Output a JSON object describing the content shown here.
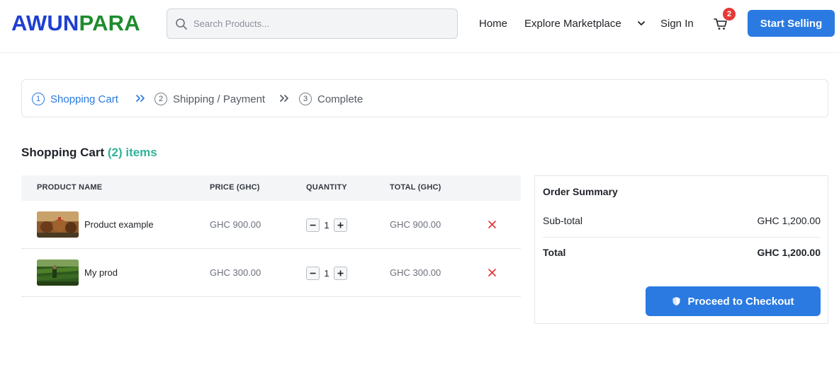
{
  "header": {
    "logo_part1": "AWUN",
    "logo_part2": "PARA",
    "search_placeholder": "Search Products...",
    "nav": {
      "home": "Home",
      "explore": "Explore Marketplace",
      "signin": "Sign In"
    },
    "cart_count": "2",
    "start_selling": "Start Selling"
  },
  "steps": [
    {
      "num": "1",
      "label": "Shopping Cart",
      "active": true
    },
    {
      "num": "2",
      "label": "Shipping / Payment",
      "active": false
    },
    {
      "num": "3",
      "label": "Complete",
      "active": false
    }
  ],
  "cart": {
    "title": "Shopping Cart",
    "count_text": "(2) items",
    "columns": [
      "PRODUCT NAME",
      "PRICE (GHC)",
      "QUANTITY",
      "TOTAL (GHC)"
    ],
    "items": [
      {
        "name": "Product example",
        "price": "GHC 900.00",
        "quantity": "1",
        "total": "GHC 900.00",
        "thumb": "chickens-photo"
      },
      {
        "name": "My prod",
        "price": "GHC 300.00",
        "quantity": "1",
        "total": "GHC 300.00",
        "thumb": "farm-field-photo"
      }
    ]
  },
  "summary": {
    "title": "Order Summary",
    "subtotal_label": "Sub-total",
    "subtotal_value": "GHC 1,200.00",
    "total_label": "Total",
    "total_value": "GHC 1,200.00",
    "checkout_label": "Proceed to Checkout"
  },
  "colors": {
    "logo_blue": "#1f3fd1",
    "logo_green": "#1e8c2e",
    "primary": "#2a7ae2",
    "accent_teal": "#2fb39a",
    "remove_red": "#e53935"
  }
}
